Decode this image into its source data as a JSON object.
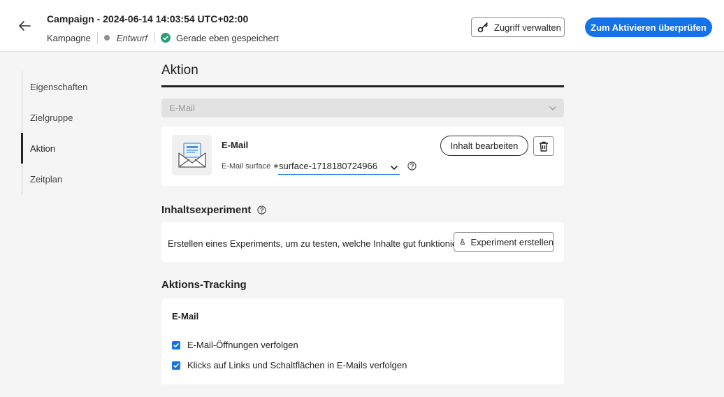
{
  "header": {
    "title": "Campaign - 2024-06-14 14:03:54 UTC+02:00",
    "type_label": "Kampagne",
    "status": "Entwurf",
    "saved_text": "Gerade eben gespeichert",
    "access_button": "Zugriff verwalten",
    "review_button": "Zum Aktivieren überprüfen"
  },
  "nav": {
    "items": [
      {
        "label": "Eigenschaften"
      },
      {
        "label": "Zielgruppe"
      },
      {
        "label": "Aktion"
      },
      {
        "label": "Zeitplan"
      }
    ]
  },
  "action": {
    "heading": "Aktion",
    "channel_select": "E-Mail",
    "card": {
      "title": "E-Mail",
      "surface_label": "E-Mail surface ∗",
      "surface_value": "surface-1718180724966",
      "edit_button": "Inhalt bearbeiten"
    }
  },
  "experiment": {
    "heading": "Inhaltsexperiment",
    "text": "Erstellen eines Experiments, um zu testen, welche Inhalte gut funktionieren.",
    "button": "Experiment erstellen"
  },
  "tracking": {
    "heading": "Aktions-Tracking",
    "subheading": "E-Mail",
    "options": [
      {
        "label": "E-Mail-Öffnungen verfolgen",
        "checked": true
      },
      {
        "label": "Klicks auf Links und Schaltflächen in E-Mails verfolgen",
        "checked": true
      }
    ]
  },
  "colors": {
    "accent": "#1473e6",
    "success": "#2d9d78"
  }
}
